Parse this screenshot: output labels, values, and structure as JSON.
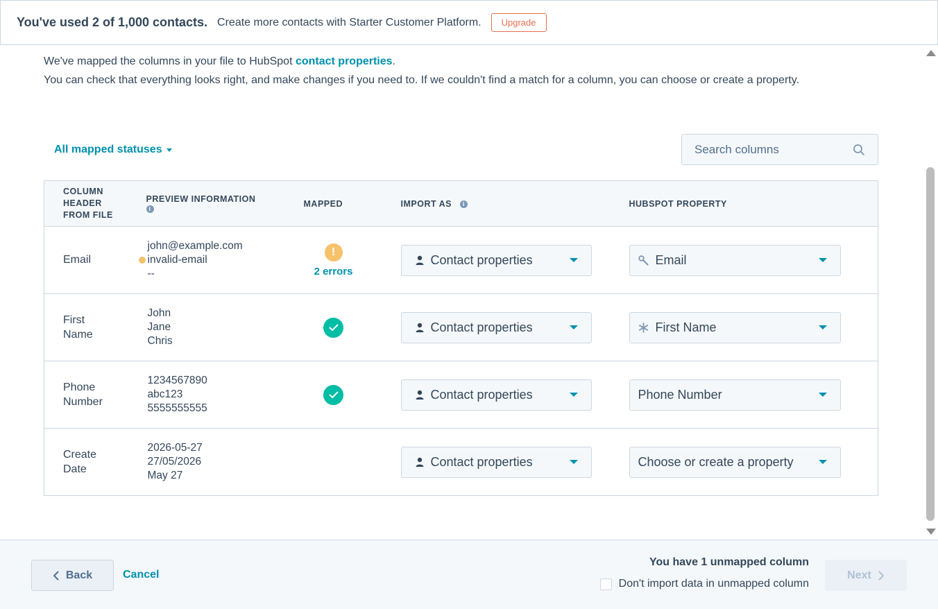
{
  "banner": {
    "title": "You've used 2 of 1,000 contacts.",
    "text": "Create more contacts with Starter Customer Platform.",
    "upgrade_label": "Upgrade"
  },
  "intro": {
    "line1_prefix": "We've mapped the columns in your file to HubSpot ",
    "line1_link": "contact properties",
    "line1_suffix": ".",
    "line2": "You can check that everything looks right, and make changes if you need to. If we couldn't find a match for a column, you can choose or create a property."
  },
  "filter": {
    "label": "All mapped statuses"
  },
  "search": {
    "placeholder": "Search columns"
  },
  "table": {
    "headers": {
      "column_header": [
        "COLUMN",
        "HEADER",
        "FROM FILE"
      ],
      "preview": "PREVIEW INFORMATION",
      "mapped": "MAPPED",
      "import_as": "IMPORT AS",
      "hubspot_property": "HUBSPOT PROPERTY"
    },
    "rows": [
      {
        "column_header": "Email",
        "preview": [
          "john@example.com",
          "invalid-email",
          "--"
        ],
        "status_text": "2 errors",
        "import_as": "Contact properties",
        "property": "Email"
      },
      {
        "column_header": "First Name",
        "preview": [
          "John",
          "Jane",
          "Chris"
        ],
        "import_as": "Contact properties",
        "property": "First Name"
      },
      {
        "column_header": "Phone Number",
        "preview": [
          "1234567890",
          "abc123",
          "5555555555"
        ],
        "import_as": "Contact properties",
        "property": "Phone Number"
      },
      {
        "column_header": "Create Date",
        "preview": [
          "2026-05-27",
          "27/05/2026",
          "May 27"
        ],
        "import_as": "Contact properties",
        "property": "Choose or create a property"
      }
    ]
  },
  "footer": {
    "back_label": "Back",
    "cancel_label": "Cancel",
    "unmapped_title": "You have 1 unmapped column",
    "unmapped_checkbox_label": "Don't import data in unmapped column",
    "next_label": "Next"
  },
  "colors": {
    "accent": "#0091ae",
    "warning": "#f5c26b",
    "success": "#00bda5",
    "upgrade": "#e66e50"
  }
}
